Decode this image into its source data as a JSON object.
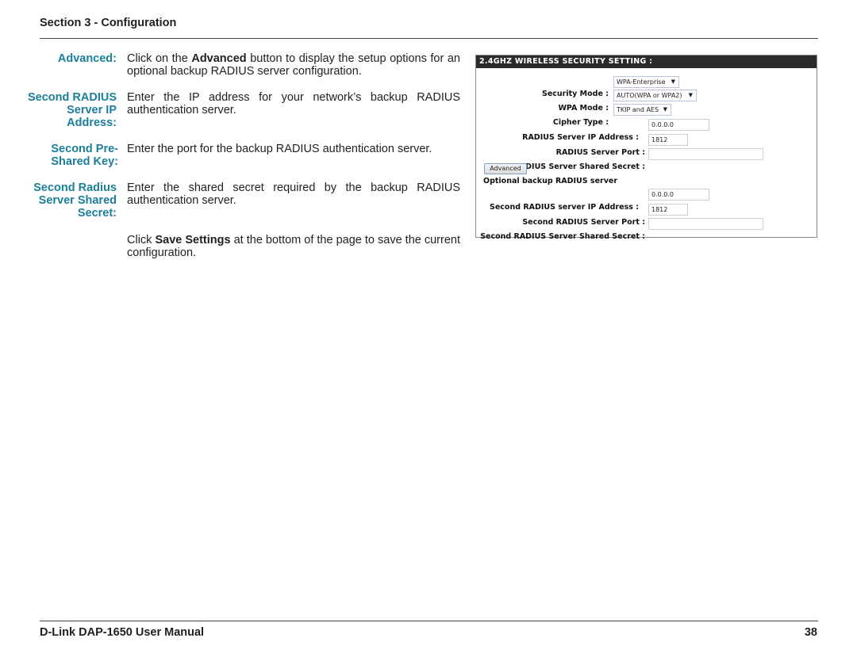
{
  "header": {
    "title": "Section 3 - Configuration"
  },
  "entries": [
    {
      "term": "Advanced:",
      "desc_pre": "Click on the ",
      "desc_bold": "Advanced",
      "desc_post": " button to display the setup options for an optional backup RADIUS server configuration."
    },
    {
      "term": "Second RADIUS Server IP Address:",
      "desc": "Enter the IP address for your network’s backup RADIUS authentication server."
    },
    {
      "term": "Second Pre-Shared Key:",
      "desc": "Enter the port for the backup RADIUS authentication server."
    },
    {
      "term": "Second Radius Server Shared Secret:",
      "desc": "Enter the shared secret required by the backup RADIUS authentication server."
    },
    {
      "term": "",
      "desc_pre": "Click ",
      "desc_bold": "Save Settings",
      "desc_post": " at the bottom of the page to save the current configuration."
    }
  ],
  "panel": {
    "title": "2.4GHZ WIRELESS SECURITY SETTING :",
    "security_mode": {
      "label": "Security Mode :",
      "value": "WPA-Enterprise"
    },
    "wpa_mode": {
      "label": "WPA Mode :",
      "value": "AUTO(WPA or WPA2)"
    },
    "cipher_type": {
      "label": "Cipher Type :",
      "value": "TKIP and AES"
    },
    "radius_ip": {
      "label": "RADIUS Server IP Address :",
      "value": "0.0.0.0"
    },
    "radius_port": {
      "label": "RADIUS Server Port :",
      "value": "1812"
    },
    "radius_secret": {
      "label": "RADIUS Server Shared Secret :",
      "value": ""
    },
    "advanced_button": "Advanced",
    "optional_title": "Optional backup RADIUS server",
    "second_ip": {
      "label": "Second RADIUS server IP Address :",
      "value": "0.0.0.0"
    },
    "second_port": {
      "label": "Second RADIUS Server Port :",
      "value": "1812"
    },
    "second_secret": {
      "label": "Second RADIUS Server Shared Secret :",
      "value": ""
    },
    "dropdown_arrow": "▼"
  },
  "footer": {
    "manual": "D-Link DAP-1650 User Manual",
    "page": "38"
  }
}
